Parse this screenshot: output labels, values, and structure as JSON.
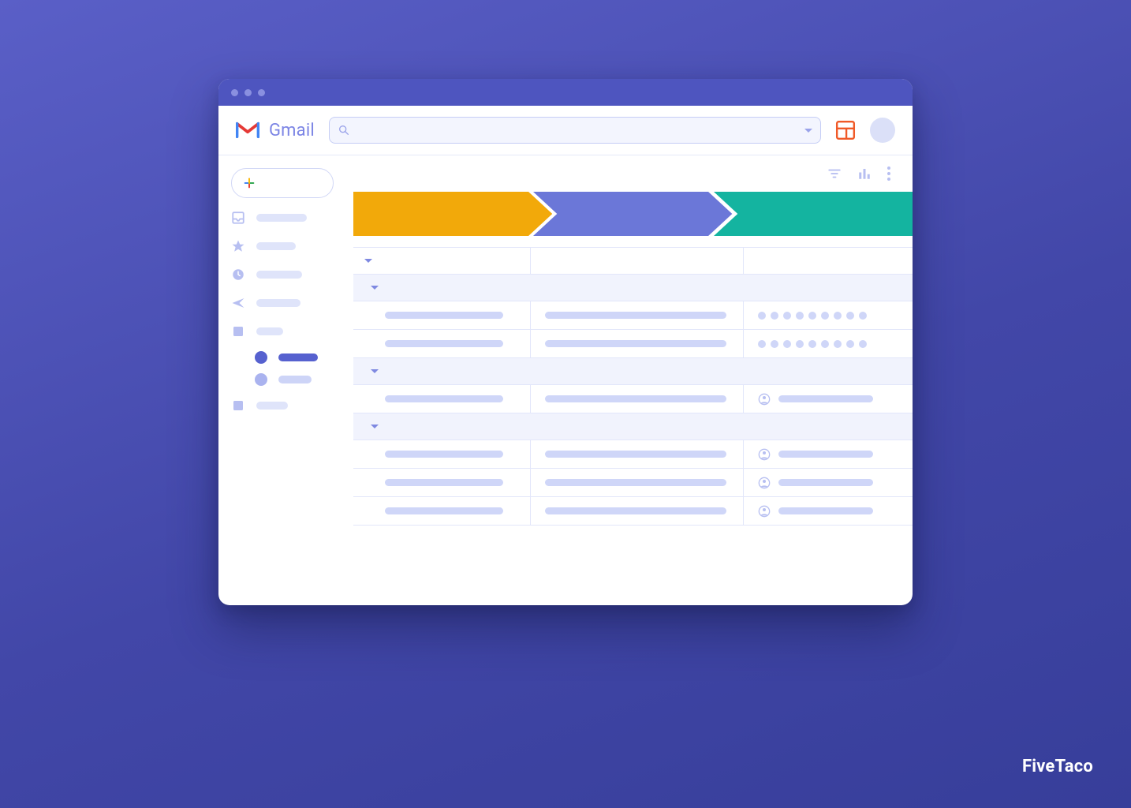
{
  "app": {
    "name": "Gmail"
  },
  "search": {
    "placeholder": ""
  },
  "colors": {
    "accent_blue": "#5661cf",
    "stage1": "#f2a90a",
    "stage2": "#6b77d8",
    "stage3": "#14b4a0",
    "app_icon": "#f05a28"
  },
  "compose": {
    "label": ""
  },
  "sidebar": {
    "items": [
      {
        "icon": "inbox-icon"
      },
      {
        "icon": "star-icon"
      },
      {
        "icon": "clock-icon"
      },
      {
        "icon": "send-icon"
      },
      {
        "icon": "square-icon"
      }
    ],
    "nested": [
      {
        "style": "solid"
      },
      {
        "style": "light"
      }
    ],
    "extra": [
      {
        "icon": "square-icon"
      }
    ]
  },
  "toolbar": {
    "filter": "filter-icon",
    "stats": "stats-icon",
    "more": "more-icon"
  },
  "pipeline": {
    "stages": [
      {
        "name": "stage-1",
        "color": "#f2a90a"
      },
      {
        "name": "stage-2",
        "color": "#6b77d8"
      },
      {
        "name": "stage-3",
        "color": "#14b4a0"
      }
    ]
  },
  "grid": {
    "columns": 3,
    "sections": [
      {
        "rows": [
          {
            "col3_type": "dots",
            "dot_count": 9
          },
          {
            "col3_type": "dots",
            "dot_count": 9
          }
        ]
      },
      {
        "rows": [
          {
            "col3_type": "user"
          }
        ]
      },
      {
        "rows": [
          {
            "col3_type": "user"
          },
          {
            "col3_type": "user"
          },
          {
            "col3_type": "user"
          }
        ]
      }
    ]
  },
  "watermark": "FiveTaco"
}
